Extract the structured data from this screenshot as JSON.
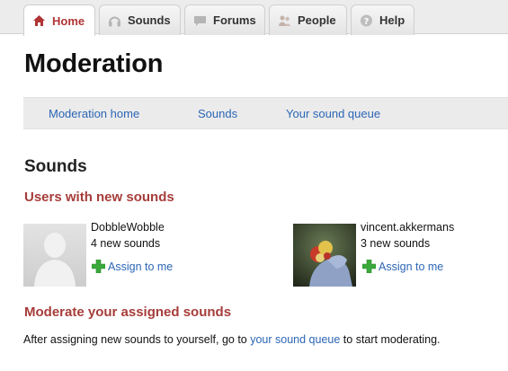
{
  "tabs": [
    {
      "label": "Home",
      "icon": "home-icon",
      "active": true
    },
    {
      "label": "Sounds",
      "icon": "headphones-icon",
      "active": false
    },
    {
      "label": "Forums",
      "icon": "speech-bubble-icon",
      "active": false
    },
    {
      "label": "People",
      "icon": "people-icon",
      "active": false
    },
    {
      "label": "Help",
      "icon": "help-icon",
      "active": false
    }
  ],
  "page": {
    "title": "Moderation"
  },
  "subnav": {
    "moderation_home": "Moderation home",
    "sounds": "Sounds",
    "queue": "Your sound queue"
  },
  "sounds_section": {
    "title": "Sounds",
    "users_heading": "Users with new sounds",
    "users": [
      {
        "name": "DobbleWobble",
        "count": "4 new sounds",
        "assign": "Assign to me",
        "avatar": "default-avatar"
      },
      {
        "name": "vincent.akkermans",
        "count": "3 new sounds",
        "assign": "Assign to me",
        "avatar": "photo-avatar"
      }
    ],
    "moderate_heading": "Moderate your assigned sounds",
    "footer": {
      "before": "After assigning new sounds to yourself, go to ",
      "link": "your sound queue",
      "after": " to start moderating."
    }
  },
  "colors": {
    "accent_red": "#a63d3a",
    "link_blue": "#2c66b5",
    "plus_green": "#3aa83a"
  }
}
